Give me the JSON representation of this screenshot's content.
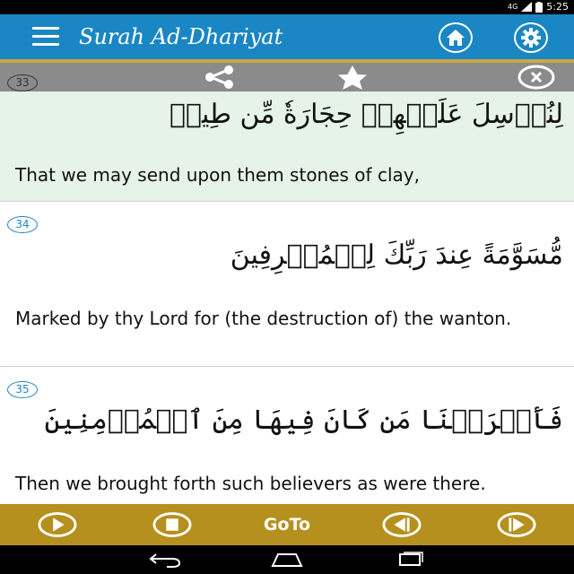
{
  "status_bar": {
    "network": "4G",
    "time": "5:25"
  },
  "app_bar": {
    "title": "Surah Ad-Dhariyat",
    "icons": {
      "menu": "menu-icon",
      "home": "home-icon",
      "settings": "gear-icon"
    },
    "colors": {
      "background": "#1a86c4",
      "action_bar": "#8b8b8b",
      "accent": "#caa646"
    }
  },
  "action_bar": {
    "icons": [
      "share-icon",
      "star-icon",
      "close-icon"
    ]
  },
  "verses": [
    {
      "number": "33",
      "arabic": "لِنُرۡسِلَ عَلَيۡهِمۡ حِجَارَةٗ مِّن طِينٖ",
      "translation": "That we may send upon them stones of clay,",
      "highlighted": true
    },
    {
      "number": "34",
      "arabic": "مُّسَوَّمَةً عِندَ رَبِّكَ لِلۡمُسۡرِفِينَ",
      "translation": "Marked by thy Lord for (the destruction of) the wanton.",
      "highlighted": false
    },
    {
      "number": "35",
      "arabic": "فَأَخۡرَجۡنَا مَن كَانَ فِيهَا مِنَ ٱلۡمُؤۡمِنِينَ",
      "translation": "Then we brought forth such believers as were there.",
      "highlighted": false
    }
  ],
  "bottom_bar": {
    "goto_label": "GoTo",
    "icons": [
      "play-icon",
      "stop-icon",
      "previous-icon",
      "next-icon"
    ],
    "background": "#b5901e"
  },
  "nav_bar": {
    "icons": [
      "back-icon",
      "home-nav-icon",
      "recents-icon"
    ]
  }
}
